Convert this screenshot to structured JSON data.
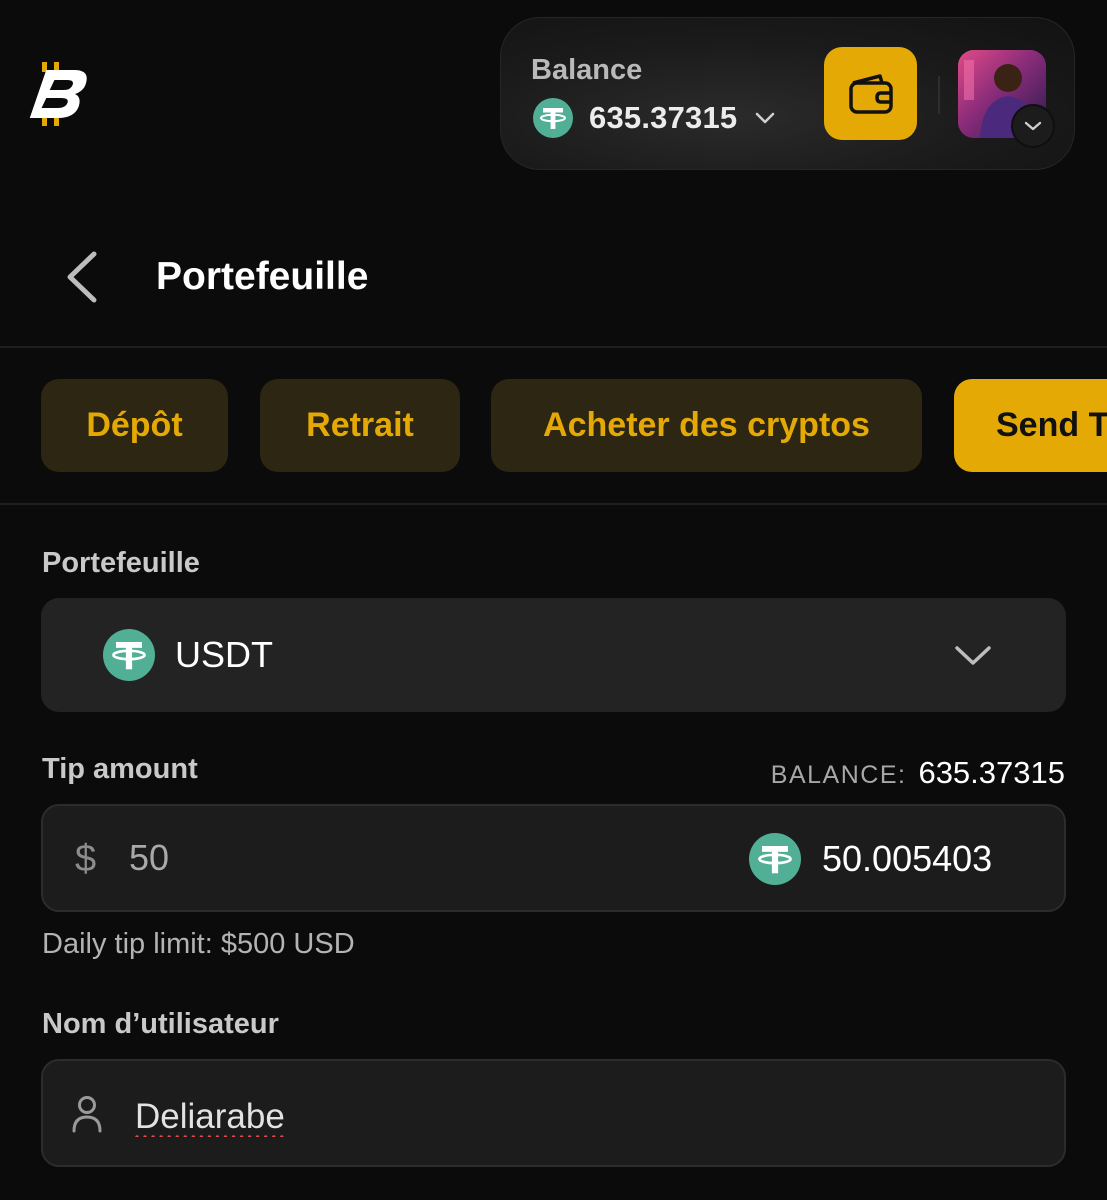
{
  "header": {
    "logo_icon": "bc-game-logo-icon",
    "balance_label": "Balance",
    "balance_amount": "635.37315",
    "balance_currency_icon": "tether-icon",
    "wallet_icon": "wallet-icon",
    "avatar_icon": "avatar-chevron-icon"
  },
  "page": {
    "title": "Portefeuille",
    "back_icon": "chevron-left-icon"
  },
  "tabs": [
    {
      "label": "Dépôt",
      "active": false
    },
    {
      "label": "Retrait",
      "active": false
    },
    {
      "label": "Acheter des cryptos",
      "active": false
    },
    {
      "label": "Send Tip",
      "active": true
    }
  ],
  "form": {
    "wallet_label": "Portefeuille",
    "wallet_value": "USDT",
    "tip_label": "Tip amount",
    "balance_key": "BALANCE:",
    "balance_value": "635.37315",
    "currency_symbol": "$",
    "usd_value": "50",
    "crypto_value": "50.005403",
    "daily_limit": "Daily tip limit: $500 USD",
    "username_label": "Nom d’utilisateur",
    "username_value": "Deliarabe"
  },
  "colors": {
    "accent": "#e5a906",
    "tether": "#50af95",
    "background": "#0b0b0b"
  }
}
